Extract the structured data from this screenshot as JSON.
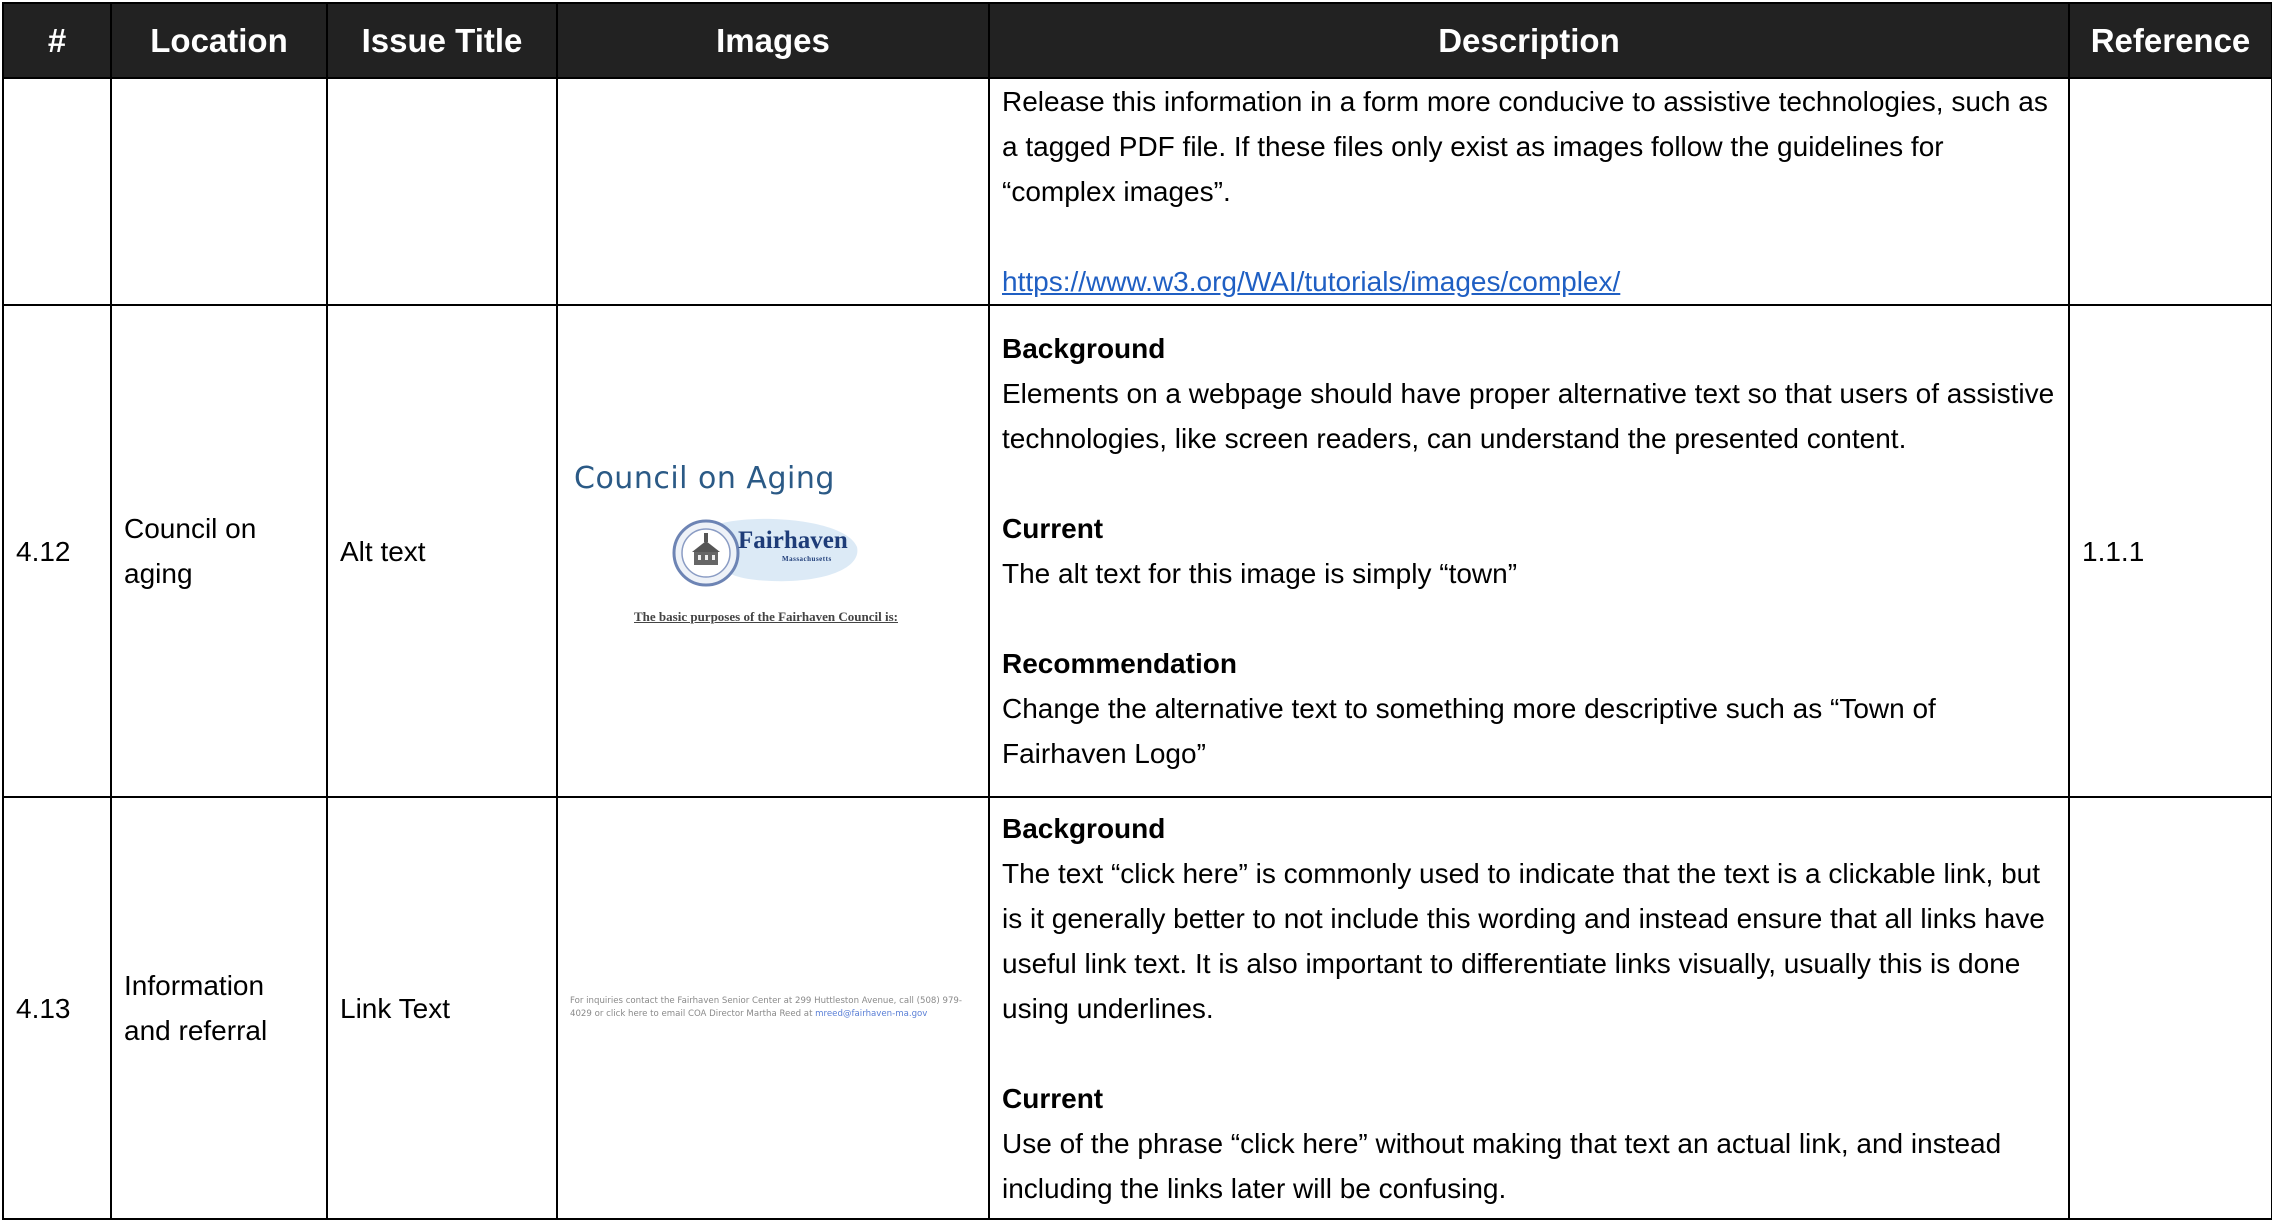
{
  "headers": {
    "num": "#",
    "location": "Location",
    "issue_title": "Issue Title",
    "images": "Images",
    "description": "Description",
    "reference": "Reference"
  },
  "rows": [
    {
      "num": "",
      "location": "",
      "issue_title": "",
      "reference": "",
      "desc_text": "Release this information in a form more conducive to assistive technologies, such as a tagged PDF file. If these files only exist as images follow the guidelines for “complex images”.",
      "link": "https://www.w3.org/WAI/tutorials/images/complex/"
    },
    {
      "num": "4.12",
      "location": "Council on aging",
      "issue_title": "Alt text",
      "reference": "1.1.1",
      "image": {
        "title": "Council on Aging",
        "logo_word": "Fairhaven",
        "logo_sub": "Massachusetts",
        "caption": "The basic purposes of the Fairhaven Council is:"
      },
      "background_heading": "Background",
      "background_text": "Elements on a webpage should have proper alternative text so that users of assistive technologies, like screen readers, can understand the presented content.",
      "current_heading": "Current",
      "current_text": "The alt text for this image is simply “town”",
      "recommendation_heading": "Recommendation",
      "recommendation_text": "Change the alternative text to something more descriptive such as “Town of Fairhaven Logo”"
    },
    {
      "num": "4.13",
      "location": "Information and referral",
      "issue_title": "Link Text",
      "reference": "",
      "image": {
        "text": "For inquiries contact the Fairhaven Senior Center at 299 Huttleston Avenue, call (508) 979-4029 or click here to email COA Director Martha Reed at",
        "email": "mreed@fairhaven-ma.gov"
      },
      "background_heading": "Background",
      "background_text": "The text “click here” is commonly used to indicate that the text is a clickable link, but is it generally better to not include this wording and instead ensure that all links have useful link text. It is also important to differentiate links visually, usually this is done using underlines.",
      "current_heading": "Current",
      "current_text": "Use of the phrase “click here” without making that text an actual link, and instead including the links later will be confusing."
    }
  ],
  "colors": {
    "header_bg": "#222222",
    "header_text": "#ffffff",
    "link": "#1f5fc3"
  }
}
